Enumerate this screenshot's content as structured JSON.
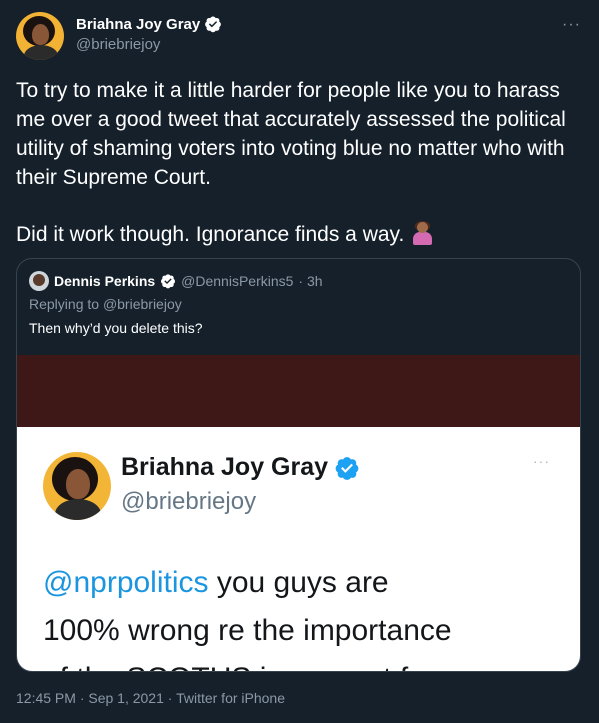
{
  "author": {
    "name": "Briahna Joy Gray",
    "handle": "@briebriejoy",
    "verified": true,
    "avatar_icon": "avatar-briahna"
  },
  "more_label": "···",
  "tweet": {
    "paragraph1": "To try to make it a little harder for people like you to harass me over a good tweet that accurately assessed the political utility of shaming voters into voting blue no matter who with their Supreme Court.",
    "paragraph2": "Did it work though. Ignorance finds a way.",
    "emoji": "woman-shrugging-emoji"
  },
  "quote": {
    "name": "Dennis Perkins",
    "handle": "@DennisPerkins5",
    "time": "· 3h",
    "replying_prefix": "Replying to",
    "replying_to": "@briebriejoy",
    "text": "Then why’d you delete this?",
    "image": {
      "name": "Briahna Joy Gray",
      "handle": "@briebriejoy",
      "more": "···",
      "mention": "@nprpolitics",
      "line1_rest": " you guys are",
      "line2": "100% wrong re the importance",
      "line3": "of the SCOTUS in support for"
    }
  },
  "meta": "12:45 PM · Sep 1, 2021 · Twitter for iPhone",
  "colors": {
    "background": "#15202b",
    "verified": "#ffffff",
    "mention": "#1b95e0"
  }
}
